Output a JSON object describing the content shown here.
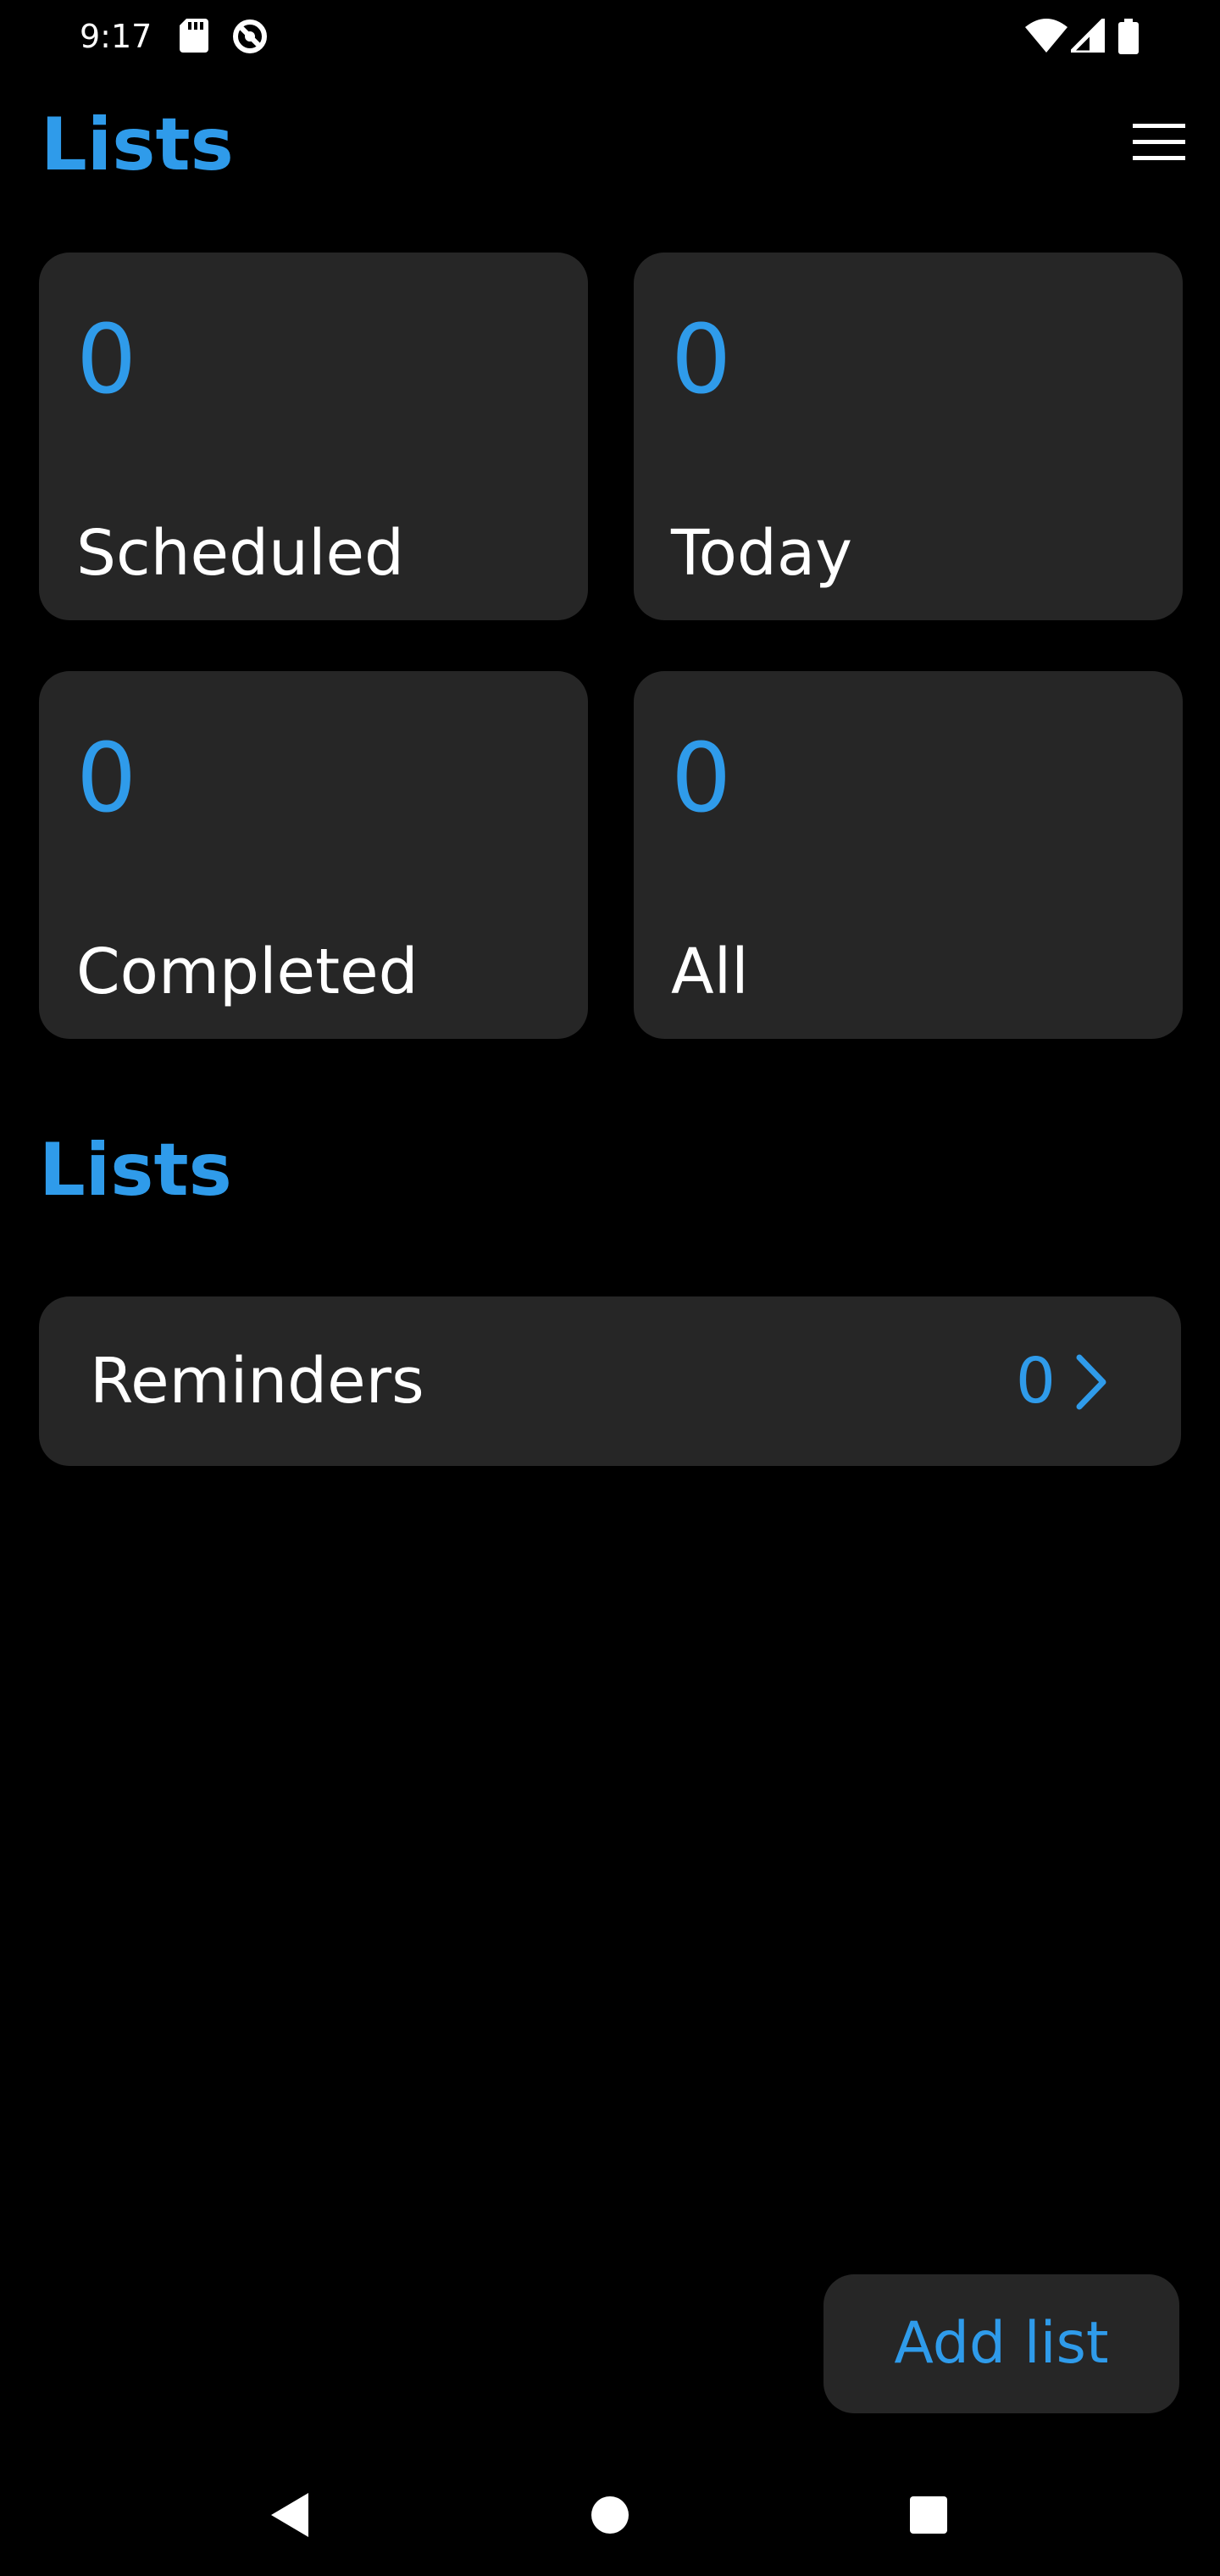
{
  "status_bar": {
    "time": "9:17",
    "icons": [
      "sd-card-icon",
      "do-not-disturb-icon",
      "wifi-icon",
      "signal-icon",
      "battery-icon"
    ]
  },
  "header": {
    "title": "Lists",
    "menu_icon": "hamburger-menu-icon"
  },
  "summary_cards": [
    {
      "count": "0",
      "label": "Scheduled"
    },
    {
      "count": "0",
      "label": "Today"
    },
    {
      "count": "0",
      "label": "Completed"
    },
    {
      "count": "0",
      "label": "All"
    }
  ],
  "lists_section": {
    "title": "Lists",
    "items": [
      {
        "label": "Reminders",
        "count": "0",
        "icon": "chevron-right-icon"
      }
    ]
  },
  "add_button": {
    "label": "Add list"
  },
  "nav_bar": {
    "icons": [
      "back-icon",
      "home-icon",
      "recents-icon"
    ]
  },
  "colors": {
    "background": "#000000",
    "card": "#262626",
    "accent": "#2f9bea",
    "text": "#ffffff"
  }
}
